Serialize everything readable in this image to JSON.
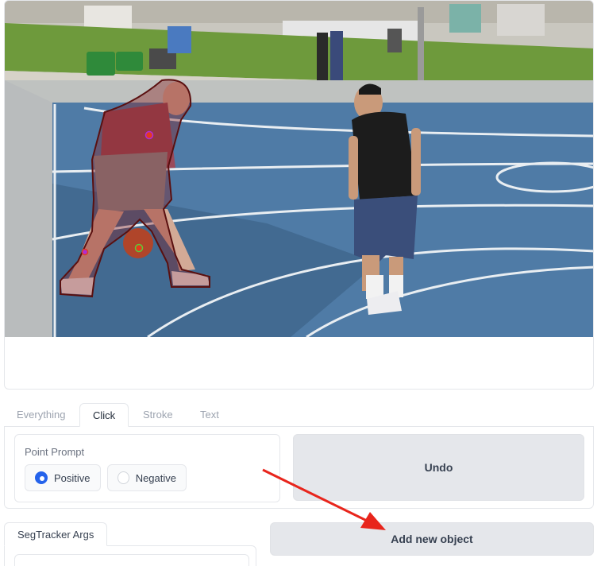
{
  "tabs": [
    "Everything",
    "Click",
    "Stroke",
    "Text"
  ],
  "active_tab": "Click",
  "point_prompt": {
    "label": "Point Prompt",
    "options": [
      "Positive",
      "Negative"
    ],
    "selected": "Positive"
  },
  "buttons": {
    "undo": "Undo",
    "add_object": "Add new object"
  },
  "segtracker_args_label": "SegTracker Args",
  "colors": {
    "mask": "#8a1a1a",
    "point_positive": "#e23a1f",
    "arrow": "#e8251c",
    "court": "#4f7ba6"
  }
}
